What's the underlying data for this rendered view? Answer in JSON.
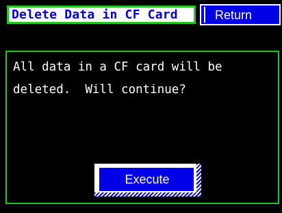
{
  "header": {
    "title": "Delete Data in CF Card",
    "return_label": "Return"
  },
  "dialog": {
    "message_line1": "All data in a CF card will be",
    "message_line2": "deleted.  Will continue?",
    "execute_label": "Execute"
  },
  "colors": {
    "background": "#000000",
    "accent_green": "#22c322",
    "button_blue": "#0000e6",
    "title_text_blue": "#0000e0",
    "text_white": "#ffffff"
  }
}
